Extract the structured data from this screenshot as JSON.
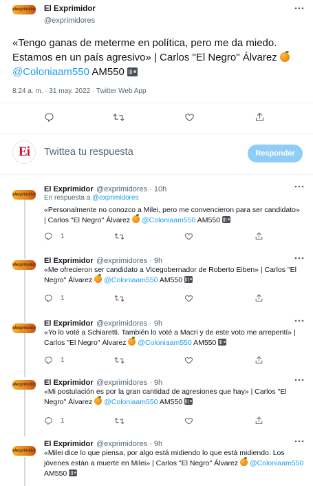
{
  "main_tweet": {
    "author_name": "El Exprimidor",
    "author_handle": "@exprimidores",
    "avatar_text": "elexprimidor",
    "text_part1": "«Tengo ganas de meterme en política, pero me da miedo. Estamos en un país agresivo» | Carlos \"El Negro\" Álvarez",
    "mention": "@Coloniaam550",
    "text_part2": "AM550",
    "timestamp": "8:24 a. m. · 31 may. 2022 · Twitter Web App"
  },
  "compose": {
    "avatar_text": "Ei",
    "placeholder": "Twittea tu respuesta",
    "button_label": "Responder"
  },
  "replies": [
    {
      "author_name": "El Exprimidor",
      "author_handle": "@exprimidores · 10h",
      "reply_to_prefix": "En respuesta a",
      "reply_to_handle": "@exprimidores",
      "text": "«Personalmente no conozco a Milei, pero me convencieron para ser candidato» | Carlos \"El Negro\" Álvarez",
      "mention": "@Coloniaam550",
      "text_end": "AM550",
      "reply_count": "1"
    },
    {
      "author_name": "El Exprimidor",
      "author_handle": "@exprimidores · 9h",
      "text": "«Me ofrecieron ser candidato a Vicegobernador de Roberto Eiben» | Carlos \"El Negro\" Álvarez",
      "mention": "@Coloniaam550",
      "text_end": "AM550",
      "reply_count": "1"
    },
    {
      "author_name": "El Exprimidor",
      "author_handle": "@exprimidores · 9h",
      "text": "«Yo lo voté a Schiaretti. También lo voté a Macri y de este voto me arrepentí» | Carlos \"El Negro\" Álvarez",
      "mention": "@Coloniaam550",
      "text_end": "AM550",
      "reply_count": "1"
    },
    {
      "author_name": "El Exprimidor",
      "author_handle": "@exprimidores · 9h",
      "text": "«Mi postulación es por la gran cantidad de agresiones que hay» | Carlos \"El Negro\" Álvarez",
      "mention": "@Coloniaam550",
      "text_end": "AM550",
      "reply_count": "1"
    },
    {
      "author_name": "El Exprimidor",
      "author_handle": "@exprimidores · 9h",
      "text": "«Milei dice lo que piensa, por algo está midiendo lo que está midiendo. Los jóvenes están a muerte en Milei» | Carlos \"El Negro\" Álvarez",
      "mention": "@Coloniaam550",
      "text_end": "AM550"
    }
  ],
  "colors": {
    "accent": "#1d9bf0",
    "text": "#0f1419",
    "muted": "#536471",
    "button_disabled": "#8ecdf7",
    "compose_avatar": "#c8102e"
  },
  "icons": [
    "more-icon",
    "reply-icon",
    "retweet-icon",
    "like-icon",
    "share-icon",
    "orange-emoji",
    "radio-emoji"
  ]
}
